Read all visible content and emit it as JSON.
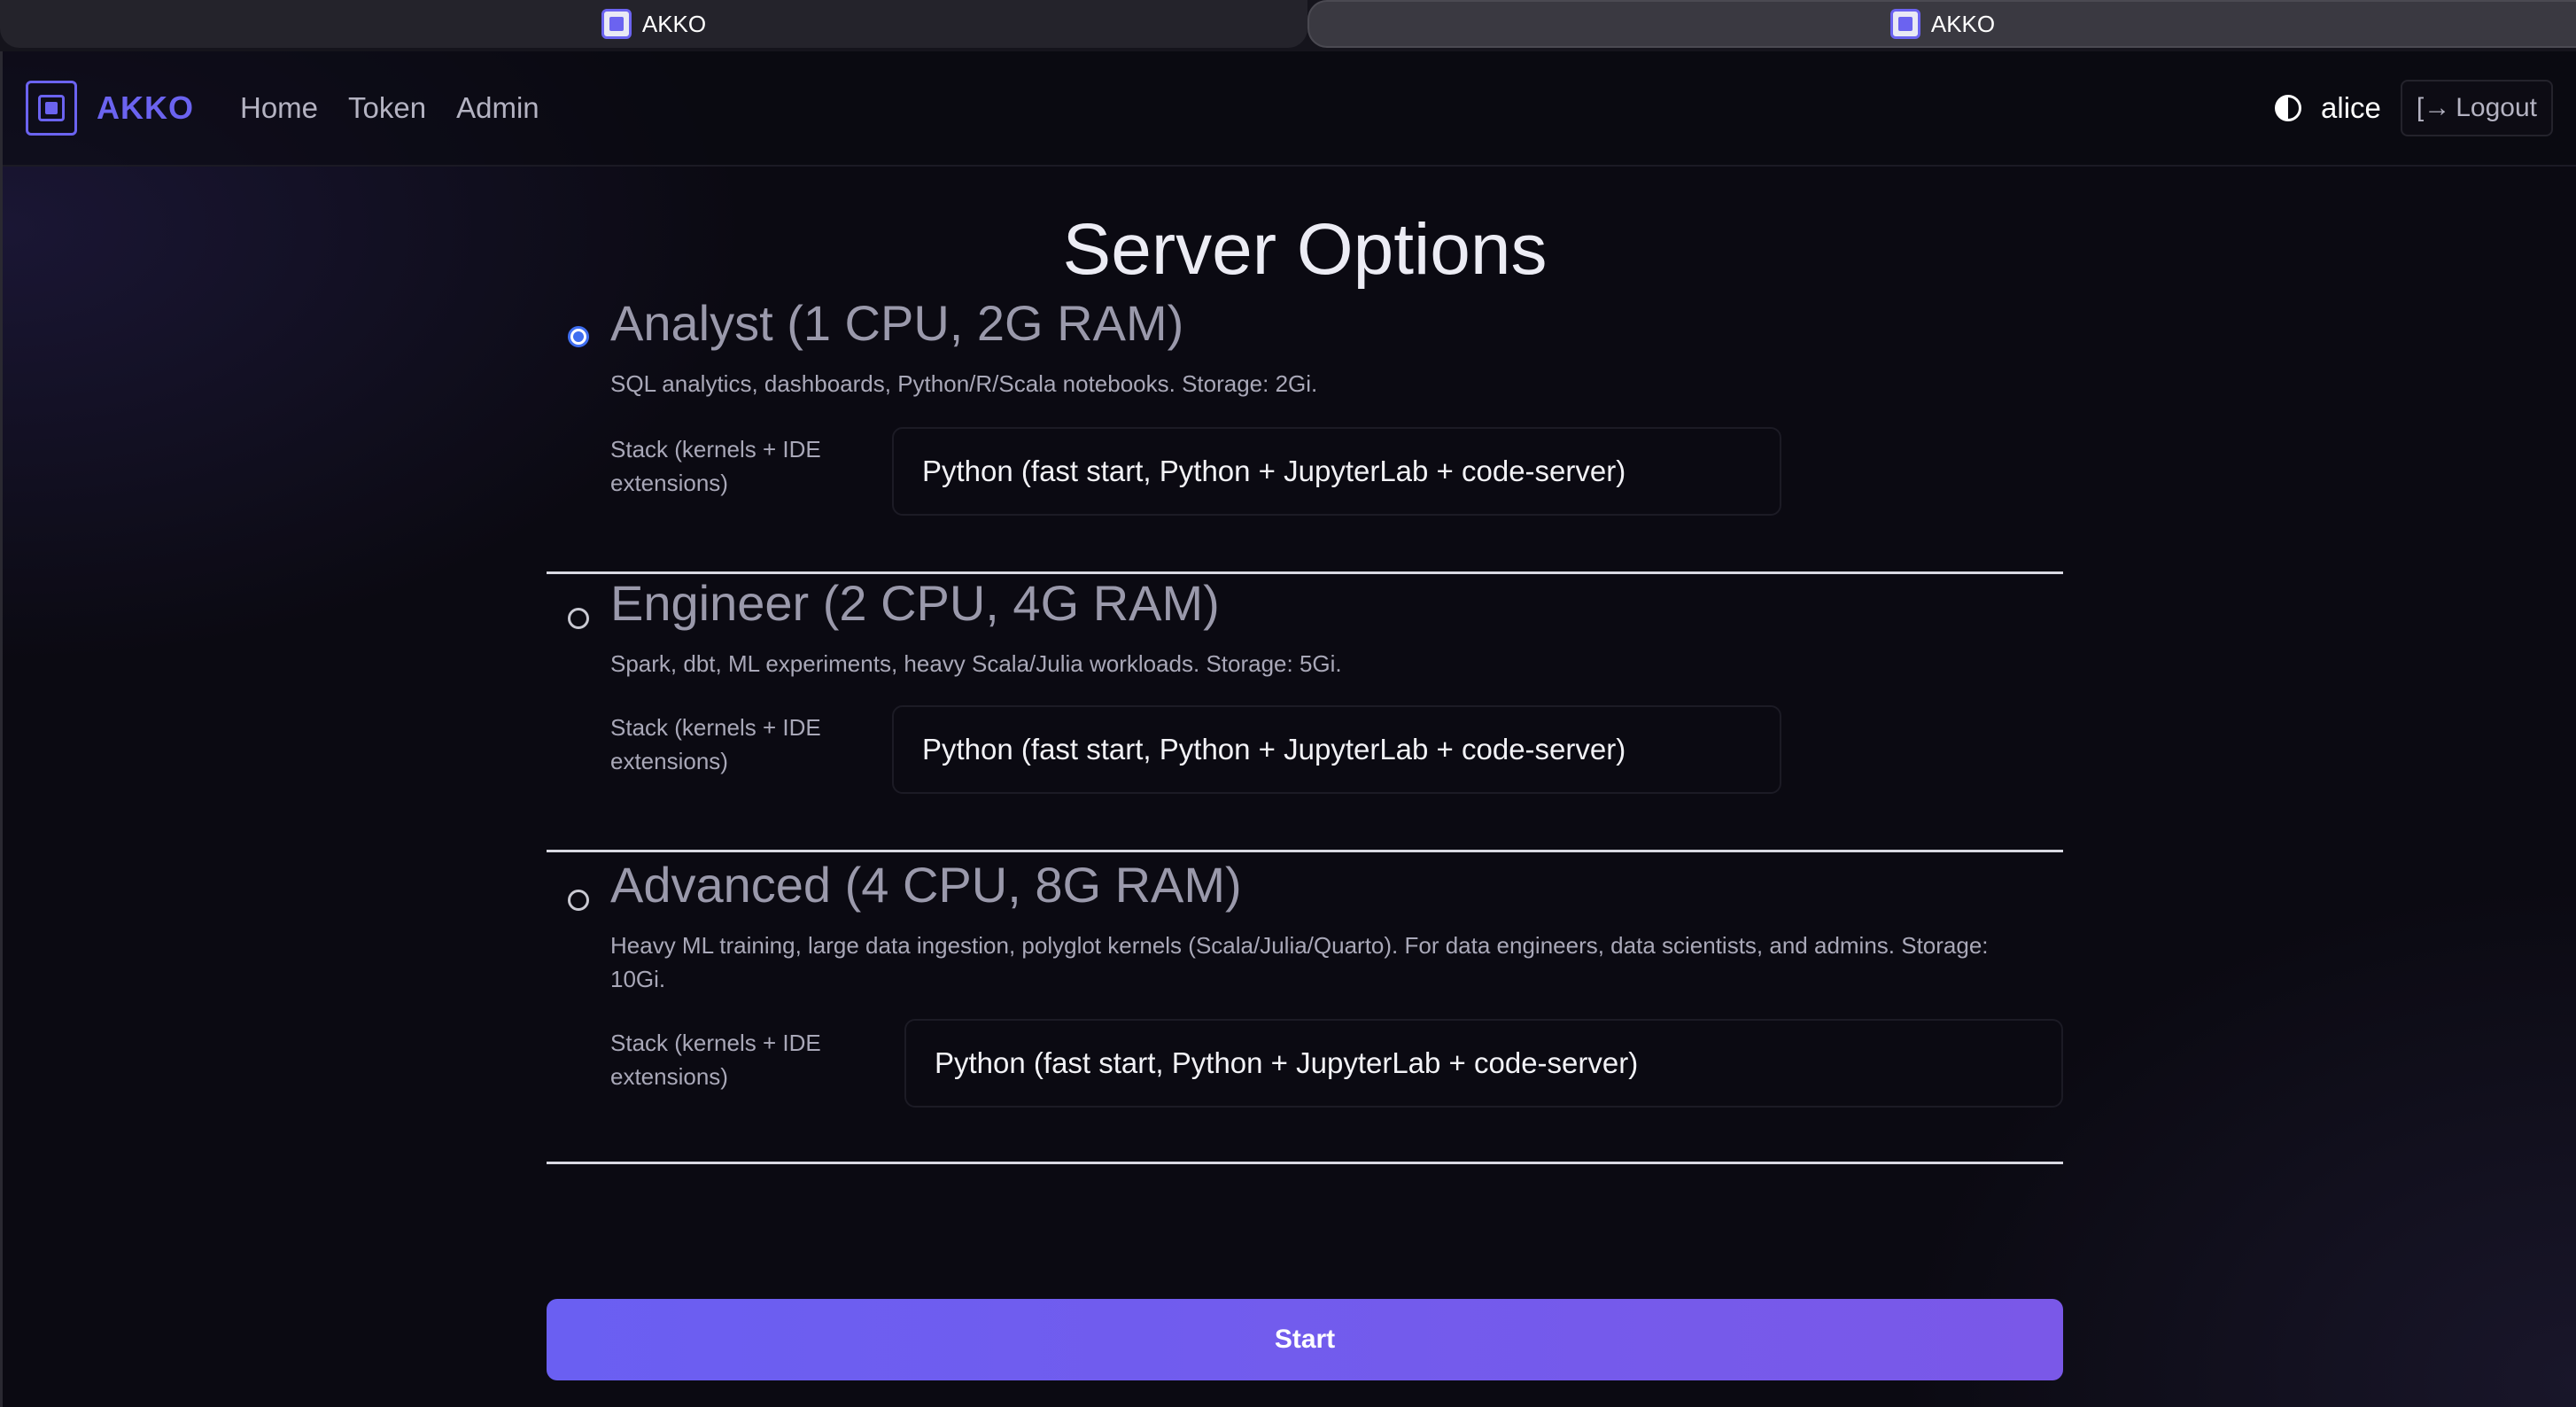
{
  "browser": {
    "tabs": [
      {
        "title": "AKKO",
        "active": false
      },
      {
        "title": "AKKO",
        "active": true
      }
    ]
  },
  "navbar": {
    "brand": "AKKO",
    "links": [
      "Home",
      "Token",
      "Admin"
    ],
    "username": "alice",
    "logout_label": "Logout"
  },
  "page": {
    "title": "Server Options",
    "options": [
      {
        "title": "Analyst (1 CPU, 2G RAM)",
        "description": "SQL analytics, dashboards, Python/R/Scala notebooks. Storage: 2Gi.",
        "stack_label": "Stack (kernels + IDE extensions)",
        "stack_value": "Python (fast start, Python + JupyterLab + code-server)",
        "selected": true
      },
      {
        "title": "Engineer (2 CPU, 4G RAM)",
        "description": "Spark, dbt, ML experiments, heavy Scala/Julia workloads. Storage: 5Gi.",
        "stack_label": "Stack (kernels + IDE extensions)",
        "stack_value": "Python (fast start, Python + JupyterLab + code-server)",
        "selected": false
      },
      {
        "title": "Advanced (4 CPU, 8G RAM)",
        "description": "Heavy ML training, large data ingestion, polyglot kernels (Scala/Julia/Quarto). For data engineers, data scientists, and admins. Storage: 10Gi.",
        "stack_label": "Stack (kernels + IDE extensions)",
        "stack_value": "Python (fast start, Python + JupyterLab + code-server)",
        "selected": false
      }
    ],
    "start_label": "Start"
  },
  "colors": {
    "accent": "#6b63f0",
    "radio_selected": "#3f6ef0",
    "button_start": "#6a5ff2",
    "button_end": "#7a58e8"
  }
}
